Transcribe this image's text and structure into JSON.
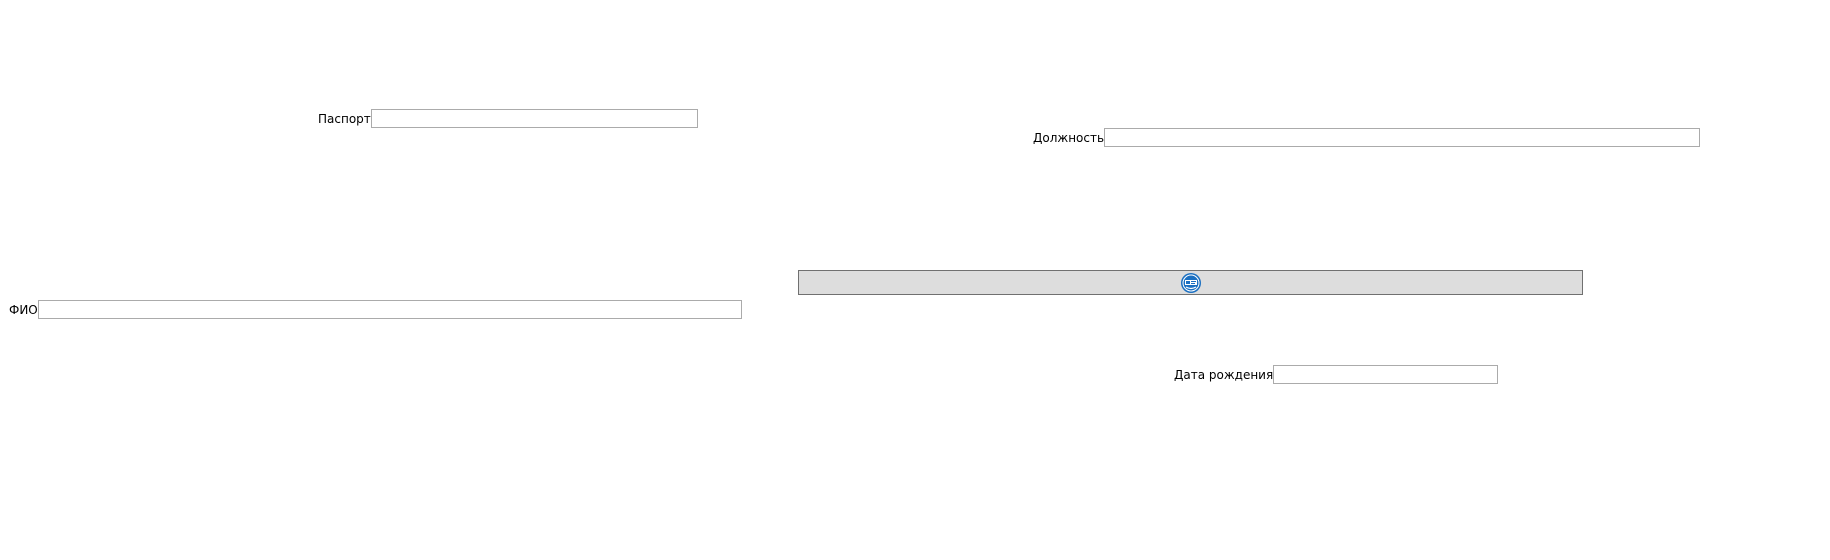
{
  "form": {
    "passport": {
      "label": "Паспорт",
      "value": ""
    },
    "position": {
      "label": "Должность",
      "value": ""
    },
    "fio": {
      "label": "ФИО",
      "value": ""
    },
    "birth_date": {
      "label": "Дата рождения",
      "value": ""
    }
  },
  "button": {
    "icon": "blue-round-emblem-icon",
    "accent_color": "#1a6fc1"
  }
}
